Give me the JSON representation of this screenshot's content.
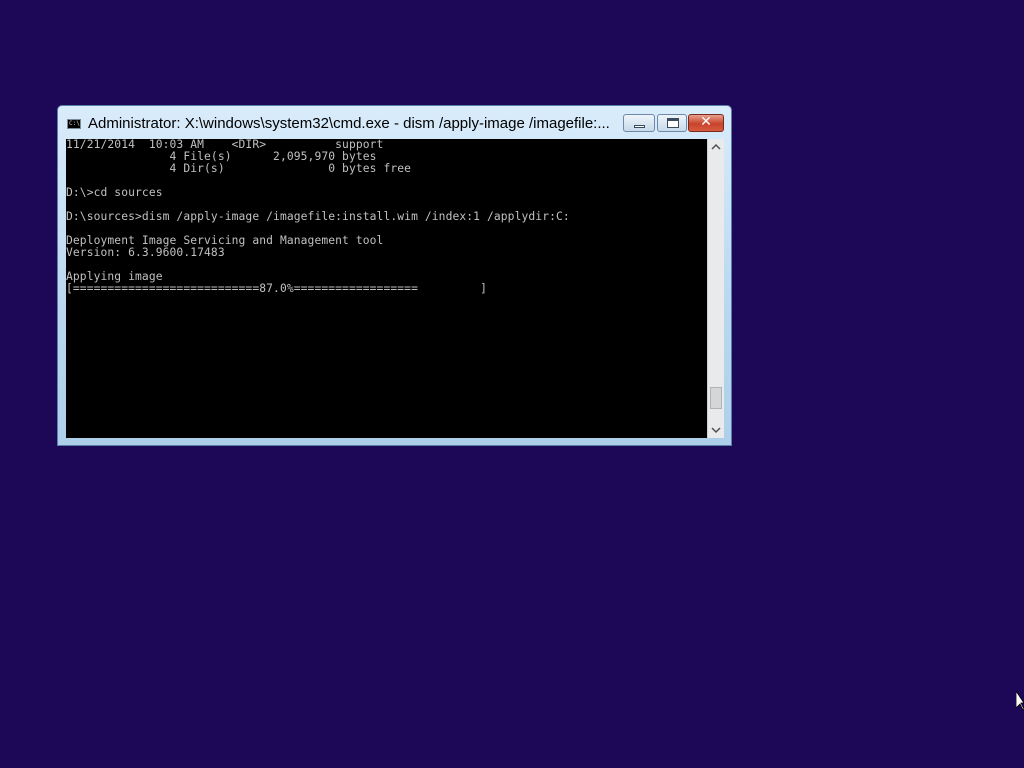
{
  "window": {
    "title": "Administrator: X:\\windows\\system32\\cmd.exe - dism  /apply-image /imagefile:...",
    "buttons": {
      "minimize": "minimize",
      "maximize": "maximize",
      "close": "✕"
    }
  },
  "console": {
    "lines": [
      "11/21/2014  10:03 AM    <DIR>          support",
      "               4 File(s)      2,095,970 bytes",
      "               4 Dir(s)               0 bytes free",
      "",
      "D:\\>cd sources",
      "",
      "D:\\sources>dism /apply-image /imagefile:install.wim /index:1 /applydir:C:",
      "",
      "Deployment Image Servicing and Management tool",
      "Version: 6.3.9600.17483",
      "",
      "Applying image",
      "[===========================87.0%==================         ]"
    ]
  },
  "progress_percent": 87.0,
  "icons": {
    "window_icon": "cmd-icon",
    "scroll_up": "chevron-up-icon",
    "scroll_down": "chevron-down-icon",
    "pointer": "mouse-pointer-icon"
  },
  "colors": {
    "desktop_background": "#1c0857",
    "console_background": "#000000",
    "console_text": "#c0c0c0",
    "close_button": "#c8432b"
  }
}
